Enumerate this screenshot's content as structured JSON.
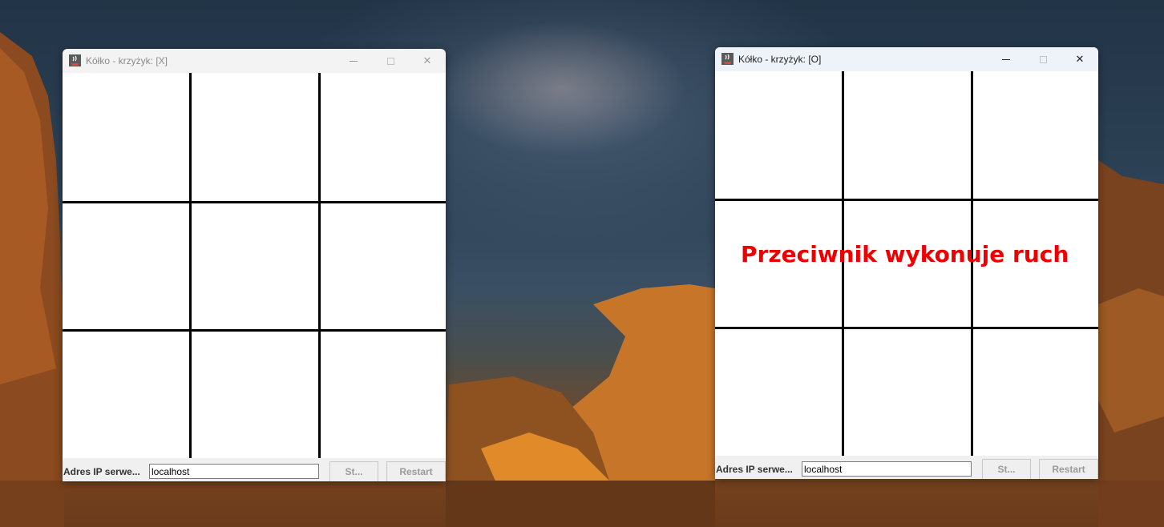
{
  "windows": {
    "left": {
      "title": "Kółko - krzyżyk: [X]",
      "ip_label": "Adres IP serwe...",
      "ip_value": "localhost",
      "start_label": "St...",
      "restart_label": "Restart",
      "status_message": ""
    },
    "right": {
      "title": "Kółko - krzyżyk: [O]",
      "ip_label": "Adres IP serwe...",
      "ip_value": "localhost",
      "start_label": "St...",
      "restart_label": "Restart",
      "status_message": "Przeciwnik wykonuje ruch"
    }
  },
  "colors": {
    "status_message": "#ee0000",
    "grid_lines": "#000000",
    "board_background": "#ffffff"
  },
  "icons": {
    "app": "java-cup-icon",
    "minimize": "minimize-icon",
    "maximize": "maximize-icon",
    "close": "close-icon"
  }
}
